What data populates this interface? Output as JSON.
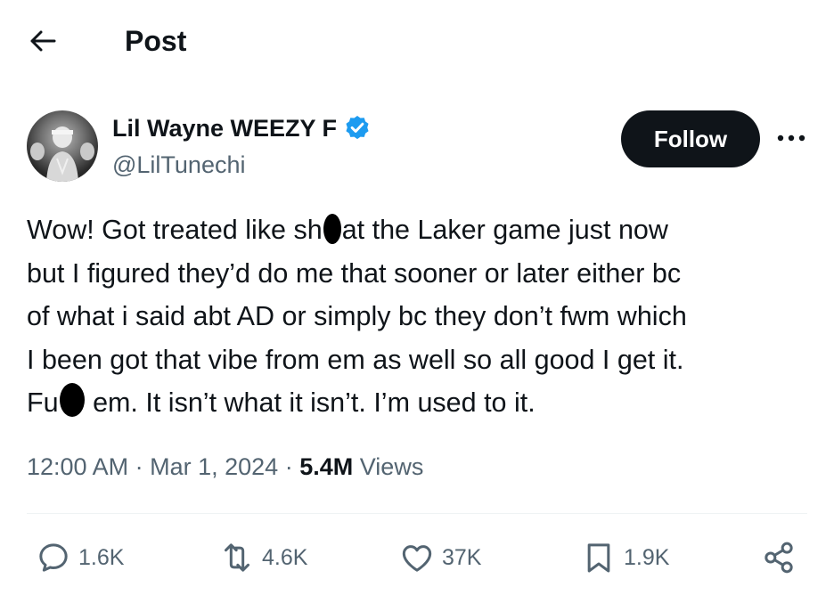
{
  "header": {
    "title": "Post"
  },
  "author": {
    "name": "Lil Wayne WEEZY F",
    "handle": "@LilTunechi",
    "verified": true
  },
  "follow_label": "Follow",
  "tweet": {
    "line1a": "Wow! Got treated like sh",
    "line1b": "at the Laker game just now",
    "line2": "but I figured they’d do me that sooner or later either bc",
    "line3": "of what i said abt AD or simply bc they don’t fwm which",
    "line4": "I been got that vibe from em as well so all good I get it.",
    "line5a": "Fu",
    "line5b": " em. It isn’t what it isn’t. I’m used to it."
  },
  "meta": {
    "time": "12:00 AM",
    "date": "Mar 1, 2024",
    "views_count": "5.4M",
    "views_label": "Views",
    "separator": "·"
  },
  "actions": {
    "replies": "1.6K",
    "reposts": "4.6K",
    "likes": "37K",
    "bookmarks": "1.9K"
  },
  "colors": {
    "text": "#0f1419",
    "secondary": "#536471",
    "verified": "#1d9bf0",
    "button": "#0f1419"
  }
}
